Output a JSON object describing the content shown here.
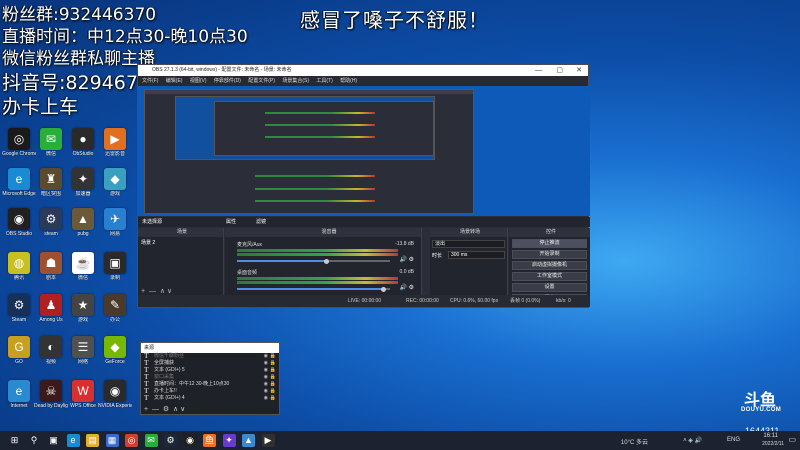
{
  "overlay": {
    "fans": "粉丝群:932446370",
    "title": "感冒了嗓子不舒服！",
    "stream_time": "直播时间：中12点30-晚10点30",
    "wechat": "微信粉丝群私聊主播",
    "douyin": "抖音号:829467936",
    "car": "办卡上车"
  },
  "desktop_icons": [
    {
      "label": "Google Chrome",
      "color": "#1a1a1a",
      "glyph": "◎"
    },
    {
      "label": "微信",
      "color": "#2aae3a",
      "glyph": "✉"
    },
    {
      "label": "ObStudio",
      "color": "#2a2a2a",
      "glyph": "●"
    },
    {
      "label": "迅雷影音",
      "color": "#e07020",
      "glyph": "▶"
    },
    {
      "label": "Microsoft Edge",
      "color": "#1a8ad4",
      "glyph": "e"
    },
    {
      "label": "暗区突围",
      "color": "#5a4a30",
      "glyph": "♜"
    },
    {
      "label": "加速器",
      "color": "#333",
      "glyph": "✦"
    },
    {
      "label": "游戏",
      "color": "#3aa0c0",
      "glyph": "◆"
    },
    {
      "label": "OBS Studio",
      "color": "#202020",
      "glyph": "◉"
    },
    {
      "label": "steam",
      "color": "#2a3a5a",
      "glyph": "⚙"
    },
    {
      "label": "pubg",
      "color": "#6a5a3a",
      "glyph": "▲"
    },
    {
      "label": "网易",
      "color": "#2a80d0",
      "glyph": "✈"
    },
    {
      "label": "腾讯",
      "color": "#c8c020",
      "glyph": "◍"
    },
    {
      "label": "剧本",
      "color": "#a05030",
      "glyph": "☗"
    },
    {
      "label": "微信",
      "color": "#fff",
      "glyph": "☕"
    },
    {
      "label": "录制",
      "color": "#2a2a2a",
      "glyph": "▣"
    },
    {
      "label": "Steam",
      "color": "#173058",
      "glyph": "⚙"
    },
    {
      "label": "Among Us",
      "color": "#b02020",
      "glyph": "♟"
    },
    {
      "label": "游戏",
      "color": "#444",
      "glyph": "★"
    },
    {
      "label": "办公",
      "color": "#4a3a2a",
      "glyph": "✎"
    },
    {
      "label": "GO",
      "color": "#c8a020",
      "glyph": "G"
    },
    {
      "label": "视频",
      "color": "#333",
      "glyph": "◐"
    },
    {
      "label": "网络",
      "color": "#505050",
      "glyph": "☰"
    },
    {
      "label": "GeForce",
      "color": "#76b900",
      "glyph": "◆"
    },
    {
      "label": "Internet",
      "color": "#2a8ad0",
      "glyph": "e"
    },
    {
      "label": "Dead by Daylight",
      "color": "#3a1a1a",
      "glyph": "☠"
    },
    {
      "label": "WPS Office",
      "color": "#d83030",
      "glyph": "W"
    },
    {
      "label": "NVIDIA Experience",
      "color": "#2a2a2a",
      "glyph": "◉"
    }
  ],
  "obs": {
    "title": "OBS 27.1.3 (64-bit, windows) - 配置文件: 未命名 - 场景: 未命名",
    "window_controls": [
      "—",
      "▢",
      "✕"
    ],
    "menu": [
      "文件(F)",
      "编辑(E)",
      "视图(V)",
      "停靠部件(D)",
      "配置文件(P)",
      "场景集合(S)",
      "工具(T)",
      "帮助(H)"
    ],
    "dock_tabs": {
      "filter": "未选择源",
      "props": "属性",
      "filters_btn": "滤镜"
    },
    "scenes": {
      "header": "场景",
      "items": [
        "场景 2"
      ]
    },
    "sources": {
      "header": "来源"
    },
    "mixer": {
      "header": "混音器",
      "channels": [
        {
          "name": "麦克风/Aux",
          "db": "-13.8 dB"
        },
        {
          "name": "桌面音频",
          "db": "0.0 dB"
        }
      ]
    },
    "transitions": {
      "header": "场景转场",
      "type": "淡出",
      "duration_label": "时长",
      "duration": "300 ms"
    },
    "controls": {
      "header": "控件",
      "buttons": [
        "停止推流",
        "开始录制",
        "启动虚拟摄像机",
        "工作室模式",
        "设置",
        "退出"
      ]
    },
    "status": {
      "live": "LIVE: 00:00:00",
      "rec": "REC: 00:00:00",
      "cpu": "CPU: 0.6%, 60.00 fps",
      "drop": "丢帧 0 (0.0%)",
      "bitrate": "kb/s: 0"
    }
  },
  "text_sources": {
    "header": "来源",
    "items": [
      {
        "label": "微信千聊粉丝",
        "dim": true
      },
      {
        "label": "全屏捕获",
        "dim": false
      },
      {
        "label": "文本 (GDI+) 5",
        "dim": false
      },
      {
        "label": "窗口采集",
        "dim": true
      },
      {
        "label": "直播时间：中午12 30-晚上10点30",
        "dim": false
      },
      {
        "label": "办卡上车!!",
        "dim": false
      },
      {
        "label": "文本 (GDI+) 4",
        "dim": false
      }
    ],
    "footer_tools": [
      "+",
      "—",
      "⚙",
      "∧",
      "∨"
    ]
  },
  "watermark": {
    "mark": "斗鱼",
    "text": "DOUYU.COM",
    "room": "1644311"
  },
  "taskbar": {
    "items": [
      "start",
      "search",
      "taskview",
      "edge",
      "folder",
      "store",
      "chrome",
      "wechat",
      "steam",
      "obs",
      "douyu",
      "tool",
      "app",
      "media"
    ],
    "weather": "10°C 多云",
    "lang": "ENG",
    "time": "16:11",
    "date": "2022/2/11"
  }
}
